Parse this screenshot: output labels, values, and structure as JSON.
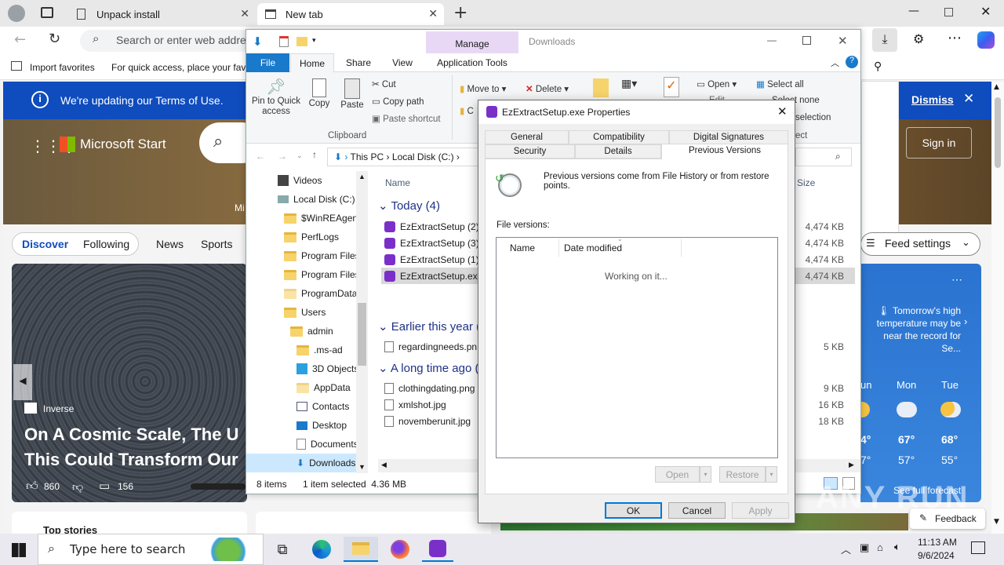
{
  "edge": {
    "tabs": [
      {
        "label": "Unpack install"
      },
      {
        "label": "New tab"
      }
    ],
    "address_placeholder": "Search or enter web address",
    "favorites": {
      "import": "Import favorites",
      "hint": "For quick access, place your favorites here on the favorites bar."
    },
    "banner": {
      "text": "We're updating our Terms of Use.",
      "dismiss": "Dismiss"
    },
    "msn": {
      "brand": "Microsoft Start",
      "sign_in": "Sign in",
      "nav": [
        "Discover",
        "Following",
        "News",
        "Sports"
      ],
      "feed_settings": "Feed settings",
      "hero": {
        "source": "Inverse",
        "title_line1": "On A Cosmic Scale, The U",
        "title_line2": "This Could Transform Our",
        "likes": "860",
        "comments": "156"
      },
      "top_stories": "Top stories",
      "hero_left_fragment": "Mi",
      "weather": {
        "alert": "Tomorrow's high temperature may be near the record for Se...",
        "days": [
          {
            "day": "un",
            "high": "4°",
            "low": "7°"
          },
          {
            "day": "Mon",
            "high": "67°",
            "low": "57°"
          },
          {
            "day": "Tue",
            "high": "68°",
            "low": "55°"
          }
        ],
        "forecast_link": "See full forecast"
      },
      "feedback": "Feedback"
    }
  },
  "explorer": {
    "title": "Downloads",
    "manage_label": "Manage",
    "tabs": [
      "File",
      "Home",
      "Share",
      "View",
      "Application Tools"
    ],
    "ribbon": {
      "pin": "Pin to Quick access",
      "copy": "Copy",
      "paste": "Paste",
      "cut": "Cut",
      "copy_path": "Copy path",
      "paste_shortcut": "Paste shortcut",
      "clipboard_group": "Clipboard",
      "move_to": "Move to",
      "delete": "Delete",
      "copy_to_fragment": "C",
      "open": "Open",
      "edit_fragment": "Edit",
      "select_all": "Select all",
      "select_none": "Select none",
      "invert_selection": "selection",
      "select_group_fragment": "ect"
    },
    "breadcrumb": [
      "This PC",
      "Local Disk (C:)"
    ],
    "tree": [
      "Videos",
      "Local Disk (C:)",
      "$WinREAgent",
      "PerfLogs",
      "Program Files",
      "Program Files",
      "ProgramData",
      "Users",
      "admin",
      ".ms-ad",
      "3D Objects",
      "AppData",
      "Contacts",
      "Desktop",
      "Documents",
      "Downloads"
    ],
    "columns": {
      "name": "Name",
      "size": "Size"
    },
    "groups": {
      "today": "Today (4)",
      "earlier": "Earlier this year (1",
      "long_ago": "A long time ago ("
    },
    "files": [
      {
        "name": "EzExtractSetup (2).",
        "size": "4,474 KB"
      },
      {
        "name": "EzExtractSetup (3).",
        "size": "4,474 KB"
      },
      {
        "name": "EzExtractSetup (1).",
        "size": "4,474 KB"
      },
      {
        "name": "EzExtractSetup.exe",
        "size": "4,474 KB"
      },
      {
        "name": "regardingneeds.pn",
        "size": "5 KB"
      },
      {
        "name": "clothingdating.png",
        "size": "9 KB"
      },
      {
        "name": "xmlshot.jpg",
        "size": "16 KB"
      },
      {
        "name": "novemberunit.jpg",
        "size": "18 KB"
      }
    ],
    "status": {
      "count": "8 items",
      "selected": "1 item selected  4.36 MB"
    }
  },
  "dialog": {
    "title": "EzExtractSetup.exe Properties",
    "tabs_row1": [
      "General",
      "Compatibility",
      "Digital Signatures"
    ],
    "tabs_row2": [
      "Security",
      "Details",
      "Previous Versions"
    ],
    "info": "Previous versions come from File History or from restore points.",
    "file_versions_label": "File versions:",
    "col_name": "Name",
    "col_date": "Date modified",
    "working": "Working on it...",
    "buttons": {
      "open": "Open",
      "restore": "Restore",
      "ok": "OK",
      "cancel": "Cancel",
      "apply": "Apply"
    }
  },
  "taskbar": {
    "search_placeholder": "Type here to search",
    "time": "11:13 AM",
    "date": "9/6/2024"
  },
  "watermark": "ANY RUN"
}
